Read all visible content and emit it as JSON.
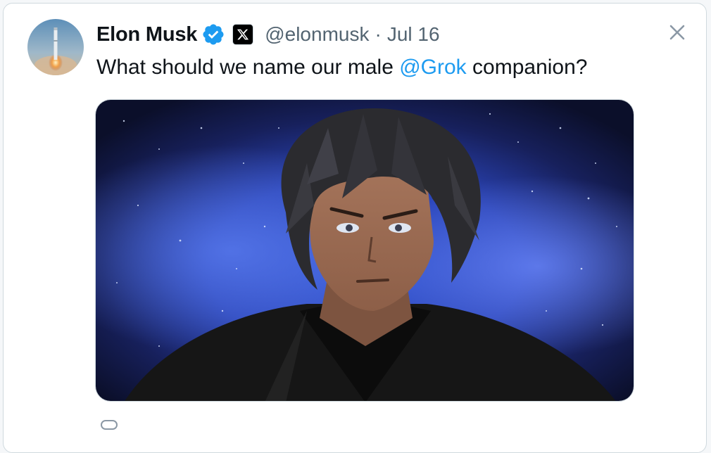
{
  "tweet": {
    "author_name": "Elon Musk",
    "handle": "@elonmusk",
    "separator": "·",
    "date": "Jul 16",
    "text_before": "What should we name our male ",
    "mention": "@Grok",
    "text_after": " companion?",
    "verified_icon": "verified-badge-icon",
    "affiliate_icon": "x-logo-icon",
    "close_icon": "close-icon"
  },
  "colors": {
    "link": "#1d9bf0",
    "verified": "#1d9bf0",
    "text": "#0f1419",
    "muted": "#536471",
    "border": "#cfd9de"
  }
}
